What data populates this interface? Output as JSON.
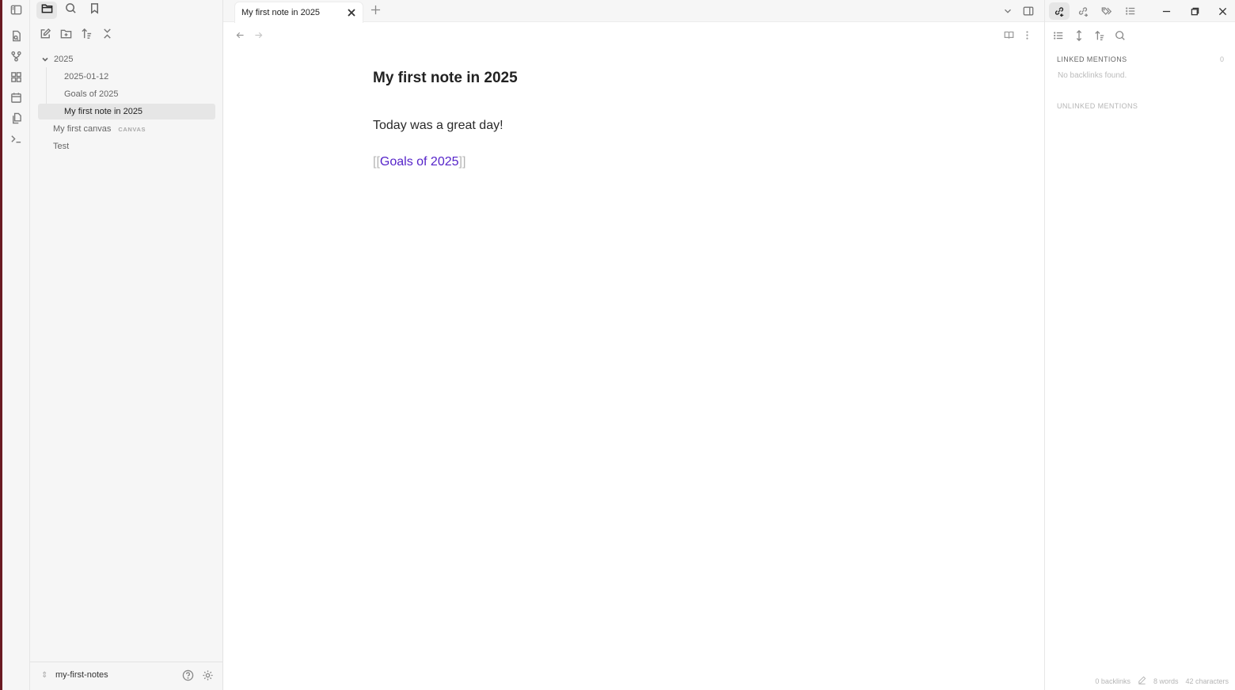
{
  "window": {
    "controls": {
      "minimize": "minimize",
      "maximize": "restore",
      "close": "close"
    }
  },
  "ribbon": {
    "items": [
      {
        "name": "quick-switcher",
        "icon": "file-search-icon"
      },
      {
        "name": "graph-view",
        "icon": "graph-icon"
      },
      {
        "name": "canvas",
        "icon": "layout-dashboard-icon"
      },
      {
        "name": "daily-note",
        "icon": "calendar-icon"
      },
      {
        "name": "templates",
        "icon": "files-icon"
      },
      {
        "name": "command-palette",
        "icon": "terminal-icon"
      }
    ]
  },
  "sidebar": {
    "tabs": [
      {
        "name": "files",
        "icon": "folder-icon",
        "active": true
      },
      {
        "name": "search",
        "icon": "search-icon",
        "active": false
      },
      {
        "name": "bookmarks",
        "icon": "bookmark-icon",
        "active": false
      }
    ],
    "toolbar": [
      "new-note",
      "new-folder",
      "sort",
      "collapse-all"
    ],
    "tree": {
      "folder": "2025",
      "children": [
        "2025-01-12",
        "Goals of 2025",
        "My first note in 2025"
      ],
      "active": "My first note in 2025",
      "root_items": [
        {
          "label": "My first canvas",
          "badge": "CANVAS"
        },
        {
          "label": "Test",
          "badge": ""
        }
      ]
    },
    "vault_name": "my-first-notes"
  },
  "tabs": [
    {
      "title": "My first note in 2025",
      "active": true
    }
  ],
  "note": {
    "title": "My first note in 2025",
    "body": "Today was a great day!",
    "link_open": "[[",
    "link_text": "Goals of 2025",
    "link_close": "]]"
  },
  "right_panel": {
    "tabs": [
      {
        "name": "backlinks",
        "icon": "link-in-icon",
        "active": true
      },
      {
        "name": "outgoing-links",
        "icon": "link-out-icon",
        "active": false
      },
      {
        "name": "tags",
        "icon": "tags-icon",
        "active": false
      },
      {
        "name": "outline",
        "icon": "list-icon",
        "active": false
      }
    ],
    "linked_mentions_label": "LINKED MENTIONS",
    "linked_mentions_count": "0",
    "no_backlinks": "No backlinks found.",
    "unlinked_mentions_label": "UNLINKED MENTIONS"
  },
  "status_bar": {
    "backlinks": "0 backlinks",
    "words": "8 words",
    "characters": "42 characters"
  }
}
